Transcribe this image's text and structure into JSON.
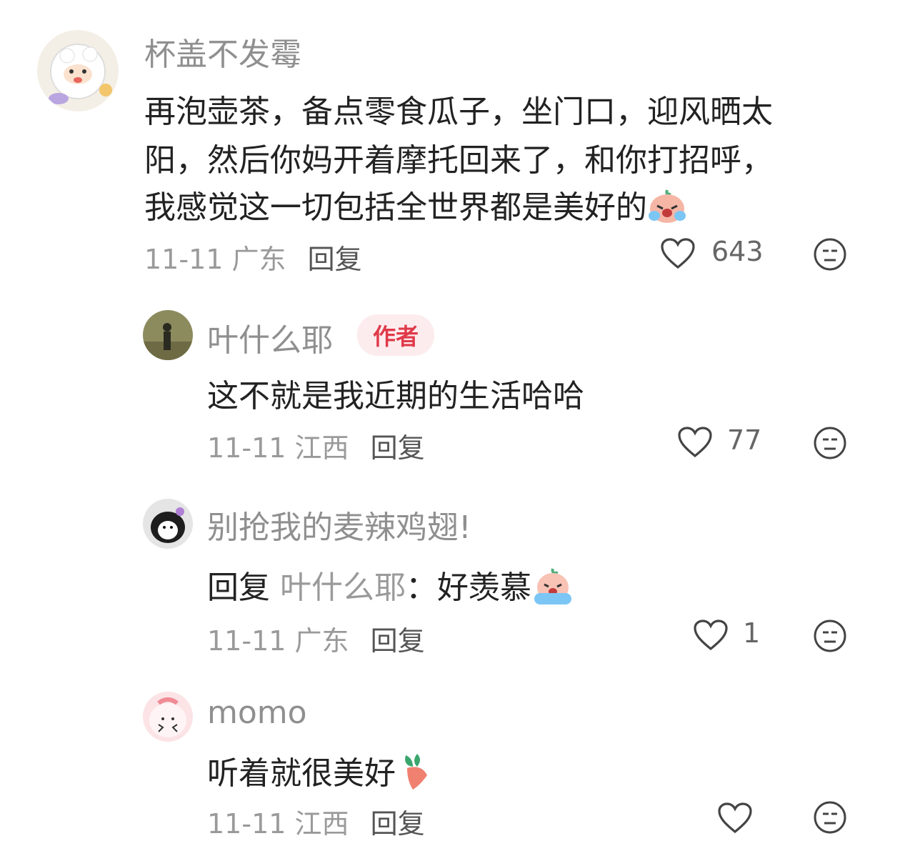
{
  "comments": [
    {
      "username": "杯盖不发霉",
      "text_lines": [
        "再泡壶茶，备点零食瓜子，坐门口，迎风晒太",
        "阳，然后你妈开着摩托回来了，和你打招呼，",
        "我感觉这一切包括全世界都是美好的"
      ],
      "date": "11-11",
      "location": "广东",
      "reply_label": "回复",
      "likes": "643"
    },
    {
      "username": "叶什么耶",
      "badge": "作者",
      "text": "这不就是我近期的生活哈哈",
      "date": "11-11",
      "location": "江西",
      "reply_label": "回复",
      "likes": "77"
    },
    {
      "username": "别抢我的麦辣鸡翅!",
      "reply_prefix": "回复",
      "reply_target": "叶什么耶",
      "reply_sep": "：",
      "text": "好羡慕",
      "date": "11-11",
      "location": "广东",
      "reply_label": "回复",
      "likes": "1"
    },
    {
      "username": "momo",
      "text": "听着就很美好",
      "date": "11-11",
      "location": "江西",
      "reply_label": "回复",
      "likes": ""
    }
  ],
  "colors": {
    "username": "#8f8f8f",
    "text": "#222222",
    "meta": "#9a9a9a",
    "badge_bg": "#fdecee",
    "badge_text": "#e03a4a"
  },
  "icons": [
    "heart-icon",
    "dislike-face-icon",
    "crying-emoji",
    "carrot-emoji"
  ]
}
